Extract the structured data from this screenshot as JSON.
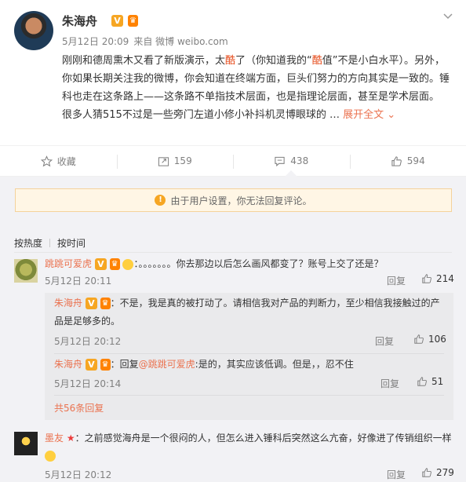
{
  "post": {
    "author": "朱海舟",
    "meta_date": "5月12日 20:09",
    "meta_source": "来自 微博 weibo.com",
    "text_part1": "刚刚和德周熏木又看了新版演示，太",
    "text_hl1": "酷",
    "text_part2": "了（你知道我的“",
    "text_hl2": "酷",
    "text_part3": "值”不是小白水平）。另外，你如果长期关注我的微博，你会知道在终端方面，巨头们努力的方向其实是一致的。锤科也走在这条路上——这条路不单指技术层面，也是指理论层面，甚至是学术层面。",
    "text_line2": "很多人猜515不过是一些旁门左道小修小补抖机灵博眼球的 …",
    "expand_label": "展开全文"
  },
  "actions": {
    "favorite": "收藏",
    "repost": "159",
    "comment": "438",
    "like": "594"
  },
  "notice": "由于用户设置，你无法回复评论。",
  "sort": {
    "hot": "按热度",
    "time": "按时间"
  },
  "comments": [
    {
      "user": "跳跳可爱虎",
      "text": "：。。。。。。。你去那边以后怎么画风都变了？账号上交了还是？",
      "date": "5月12日 20:11",
      "reply_label": "回复",
      "likes": "214",
      "replies": [
        {
          "user": "朱海舟",
          "text_l1": "：不是，我是真的被打动了。请相信我对产品的判断力，至少相信我接触过的产",
          "text_l2": "品是足够多的。",
          "date": "5月12日 20:12",
          "reply_label": "回复",
          "likes": "106"
        },
        {
          "user": "朱海舟",
          "text_pre": "：回复",
          "mention": "@跳跳可爱虎",
          "text_post": ":是的，其实应该低调。但是，，忍不住",
          "date": "5月12日 20:14",
          "reply_label": "回复",
          "likes": "51"
        }
      ],
      "more_replies": "共56条回复"
    },
    {
      "user": "墨友",
      "text": "：之前感觉海舟是一个很闷的人，但怎么进入锤科后突然这么亢奋，好像进了传销组织一样",
      "date": "5月12日 20:12",
      "reply_label": "回复",
      "likes": "279"
    }
  ],
  "colors": {
    "accent": "#eb7350",
    "badge": "#f6a623",
    "bg_comments": "#f2f2f5"
  },
  "icons": [
    "caret-down-icon",
    "star-icon",
    "repost-icon",
    "comment-icon",
    "thumb-up-icon",
    "warning-icon"
  ]
}
